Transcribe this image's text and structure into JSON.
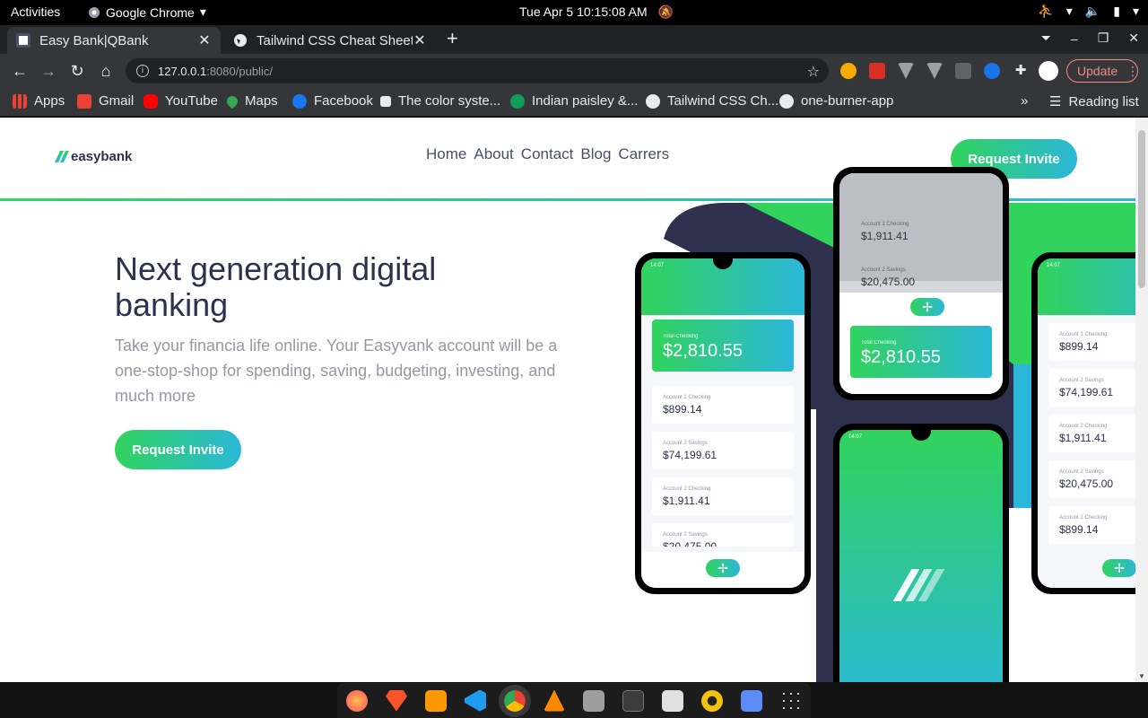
{
  "system": {
    "activities": "Activities",
    "app_name": "Google Chrome",
    "clock": "Tue Apr 5  10:15:08 AM"
  },
  "tabs": [
    {
      "title": "Easy Bank|QBank",
      "active": true
    },
    {
      "title": "Tailwind CSS Cheat Sheet",
      "active": false
    }
  ],
  "toolbar": {
    "url_host": "127.0.0.1",
    "url_path": ":8080/public/",
    "update_label": "Update"
  },
  "bookmarks": [
    "Apps",
    "Gmail",
    "YouTube",
    "Maps",
    "Facebook",
    "The color syste...",
    "Indian paisley &...",
    "Tailwind CSS Ch...",
    "one-burner-app"
  ],
  "reading_list": "Reading list",
  "site": {
    "logo": "easybank",
    "nav": [
      "Home",
      "About",
      "Contact",
      "Blog",
      "Carrers"
    ],
    "cta_label": "Request Invite",
    "hero_title": "Next generation digital banking",
    "hero_desc": "Take your financia life online. Your Easyvank account will be a one-stop-shop for spending, saving, budgeting, investing, and much more"
  },
  "mockup": {
    "time": "14:07",
    "total_label": "Total Checking",
    "total_amount": "$2,810.55",
    "accounts": [
      {
        "label": "Account 1 Checking",
        "amount": "$899.14"
      },
      {
        "label": "Account 2 Savings",
        "amount": "$74,199.61"
      },
      {
        "label": "Account 2 Checking",
        "amount": "$1,911.41"
      },
      {
        "label": "Account 2 Savings",
        "amount": "$20,475.00"
      }
    ]
  },
  "colors": {
    "brand_green": "#31d35c",
    "brand_cyan": "#2bb7da",
    "dark_blue": "#2d314d"
  }
}
